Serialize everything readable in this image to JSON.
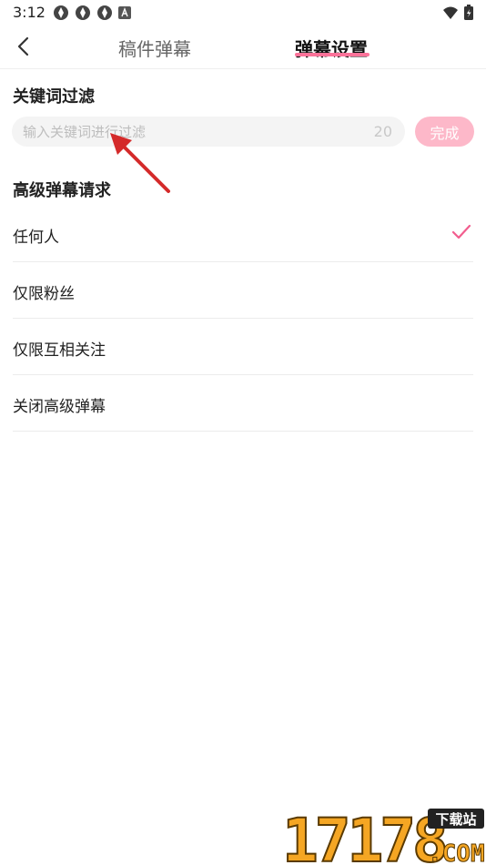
{
  "status_bar": {
    "time": "3:12",
    "icons": [
      "notification-icon",
      "notification-icon",
      "notification-icon",
      "a-icon"
    ],
    "right_icons": [
      "wifi-icon",
      "battery-icon"
    ]
  },
  "header": {
    "back_icon": "back-arrow-icon",
    "tabs": [
      {
        "label": "稿件弹幕",
        "active": false
      },
      {
        "label": "弹幕设置",
        "active": true
      }
    ],
    "accent_color": "#fb7299"
  },
  "keyword_filter": {
    "title": "关键词过滤",
    "placeholder": "输入关键词进行过滤",
    "count": "20",
    "done_label": "完成",
    "done_color": "#fdb8c9"
  },
  "advanced": {
    "title": "高级弹幕请求",
    "options": [
      {
        "label": "任何人",
        "selected": true
      },
      {
        "label": "仅限粉丝",
        "selected": false
      },
      {
        "label": "仅限互相关注",
        "selected": false
      },
      {
        "label": "关闭高级弹幕",
        "selected": false
      }
    ],
    "check_color": "#f25d8e"
  },
  "watermark": {
    "number": "17178",
    "tag": "下载站",
    "domain": ".COM"
  }
}
